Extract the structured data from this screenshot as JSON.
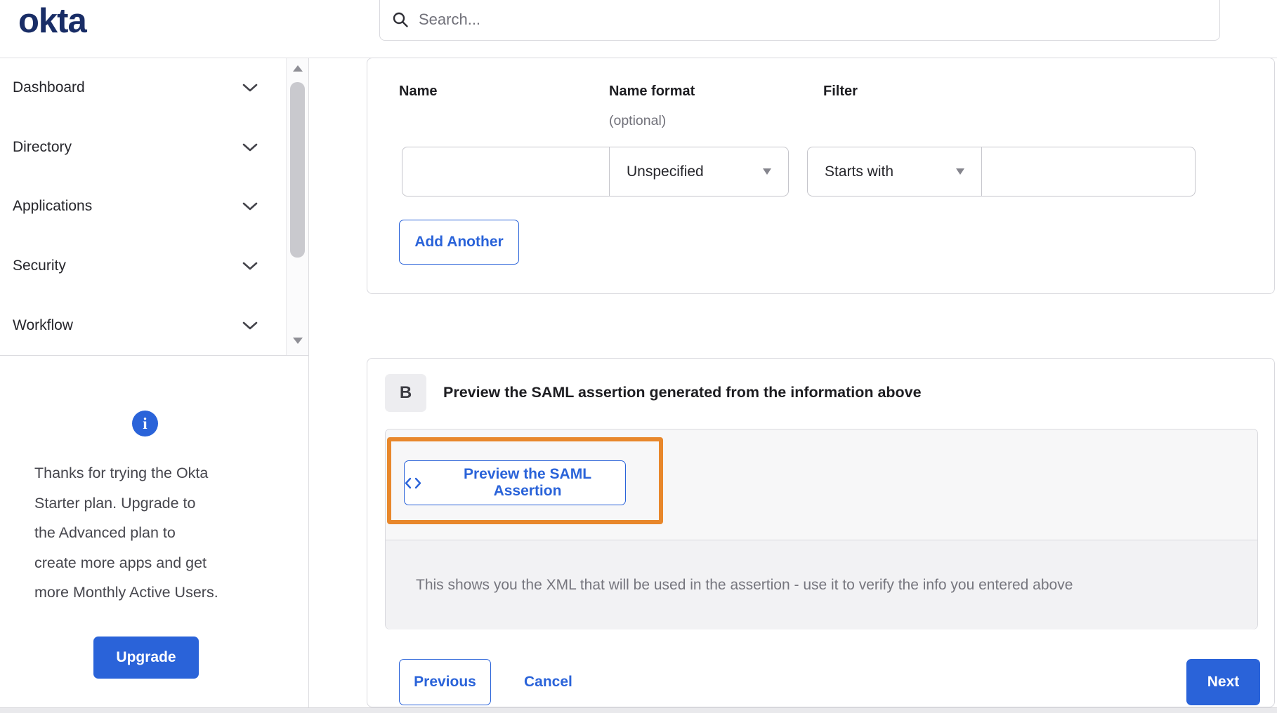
{
  "brand": {
    "logo_text": "okta"
  },
  "header": {
    "search_placeholder": "Search..."
  },
  "sidebar": {
    "items": [
      {
        "label": "Dashboard"
      },
      {
        "label": "Directory"
      },
      {
        "label": "Applications"
      },
      {
        "label": "Security"
      },
      {
        "label": "Workflow"
      }
    ],
    "upgrade": {
      "info_glyph": "i",
      "message_lines": [
        "Thanks for trying the Okta",
        "Starter plan. Upgrade to",
        "the Advanced plan to",
        "create more apps and get",
        "more Monthly Active Users."
      ],
      "button_label": "Upgrade"
    }
  },
  "attribute_form": {
    "columns": [
      {
        "label": "Name",
        "sub": ""
      },
      {
        "label": "Name format",
        "sub": "(optional)"
      },
      {
        "label": "Filter",
        "sub": ""
      }
    ],
    "name_value": "",
    "name_format_value": "Unspecified",
    "filter_type_value": "Starts with",
    "filter_value": "",
    "add_another_label": "Add Another"
  },
  "preview_section": {
    "badge": "B",
    "title": "Preview the SAML assertion generated from the information above",
    "preview_button_label": "Preview the SAML Assertion",
    "help_text": "This shows you the XML that will be used in the assertion - use it to verify the info you entered above"
  },
  "footer": {
    "previous_label": "Previous",
    "cancel_label": "Cancel",
    "next_label": "Next"
  },
  "icons": {
    "search-icon": "magnifier",
    "chevron-down-icon": "⌄",
    "dropdown-caret-icon": "▾",
    "info-icon": "i",
    "code-icon": "<>",
    "scroll-up-icon": "▲",
    "scroll-down-icon": "▼"
  },
  "colors": {
    "accent_blue": "#2a63d9",
    "logo_navy": "#192d66",
    "highlight_orange": "#e8872b"
  }
}
